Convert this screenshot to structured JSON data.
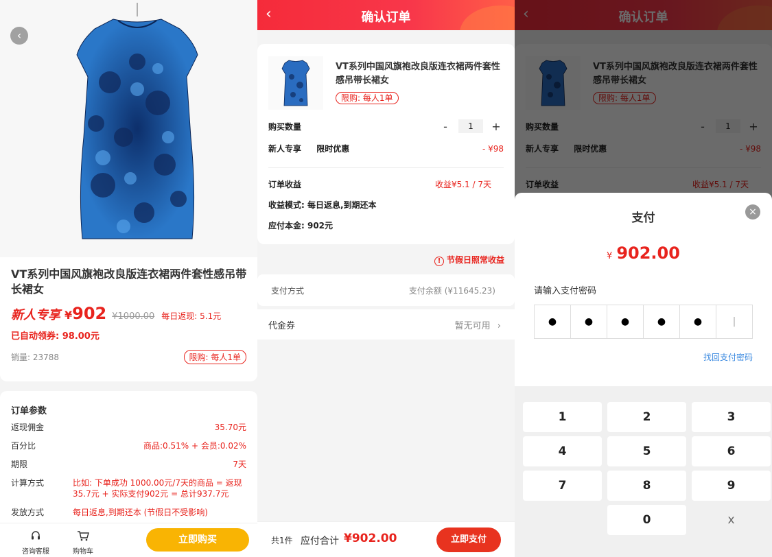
{
  "product_page": {
    "title": "VT系列中国风旗袍改良版连衣裙两件套性感吊带长裙女",
    "new_user_tag": "新人专享",
    "price_symbol": "¥",
    "price": "902",
    "original_price": "¥1000.00",
    "daily_return": "每日返现: 5.1元",
    "auto_coupon": "已自动领券:  98.00元",
    "sales": "销量: 23788",
    "limit_tag": "限购: 每人1单",
    "order_params": {
      "heading": "订单参数",
      "rows": [
        {
          "label": "返现佣金",
          "value": "35.70元"
        },
        {
          "label": "百分比",
          "value": "商品:0.51% + 会员:0.02%"
        },
        {
          "label": "期限",
          "value": "7天"
        },
        {
          "label": "计算方式",
          "value": "比如: 下单成功 1000.00元/7天的商品 = 返现35.7元 + 实际支付902元 = 总计937.7元"
        },
        {
          "label": "发放方式",
          "value": "每日返息,到期还本 (节假日不受影响)"
        }
      ]
    },
    "bottom": {
      "service": "咨询客服",
      "cart": "购物车",
      "buy_now": "立即购买"
    }
  },
  "confirm_page": {
    "header_title": "确认订单",
    "product_title": "VT系列中国风旗袍改良版连衣裙两件套性感吊带长裙女",
    "limit_tag": "限购: 每人1单",
    "quantity_label": "购买数量",
    "quantity_value": "1",
    "discount_label": "新人专享",
    "discount_sub": "限时优惠",
    "discount_value": "- ¥98",
    "income_label": "订单收益",
    "income_value": "收益¥5.1 / 7天",
    "income_mode": "收益模式: 每日返息,到期还本",
    "principal": "应付本金: 902元",
    "holiday_note": "节假日照常收益",
    "pay_method_label": "支付方式",
    "pay_method_value": "支付余额 (¥11645.23)",
    "voucher_label": "代金券",
    "voucher_value": "暂无可用",
    "total_count": "共1件",
    "total_label": "应付合计",
    "total_value": "¥902.00",
    "pay_now": "立即支付"
  },
  "payment_sheet": {
    "title": "支付",
    "currency": "¥",
    "amount": "902.00",
    "password_label": "请输入支付密码",
    "password_digits": [
      "●",
      "●",
      "●",
      "●",
      "●",
      "|"
    ],
    "forgot_password": "找回支付密码",
    "keys": [
      "1",
      "2",
      "3",
      "4",
      "5",
      "6",
      "7",
      "8",
      "9",
      "0",
      "x"
    ]
  },
  "colors": {
    "brand_red": "#e8231d",
    "header_gradient_start": "#f52b3a",
    "buy_button": "#f9b403",
    "link_blue": "#3d8be0",
    "dress_blue": "#1f5fb0"
  },
  "icons": [
    "back-arrow-icon",
    "headset-icon",
    "cart-icon",
    "chevron-right-icon",
    "close-icon",
    "info-circle-icon"
  ]
}
